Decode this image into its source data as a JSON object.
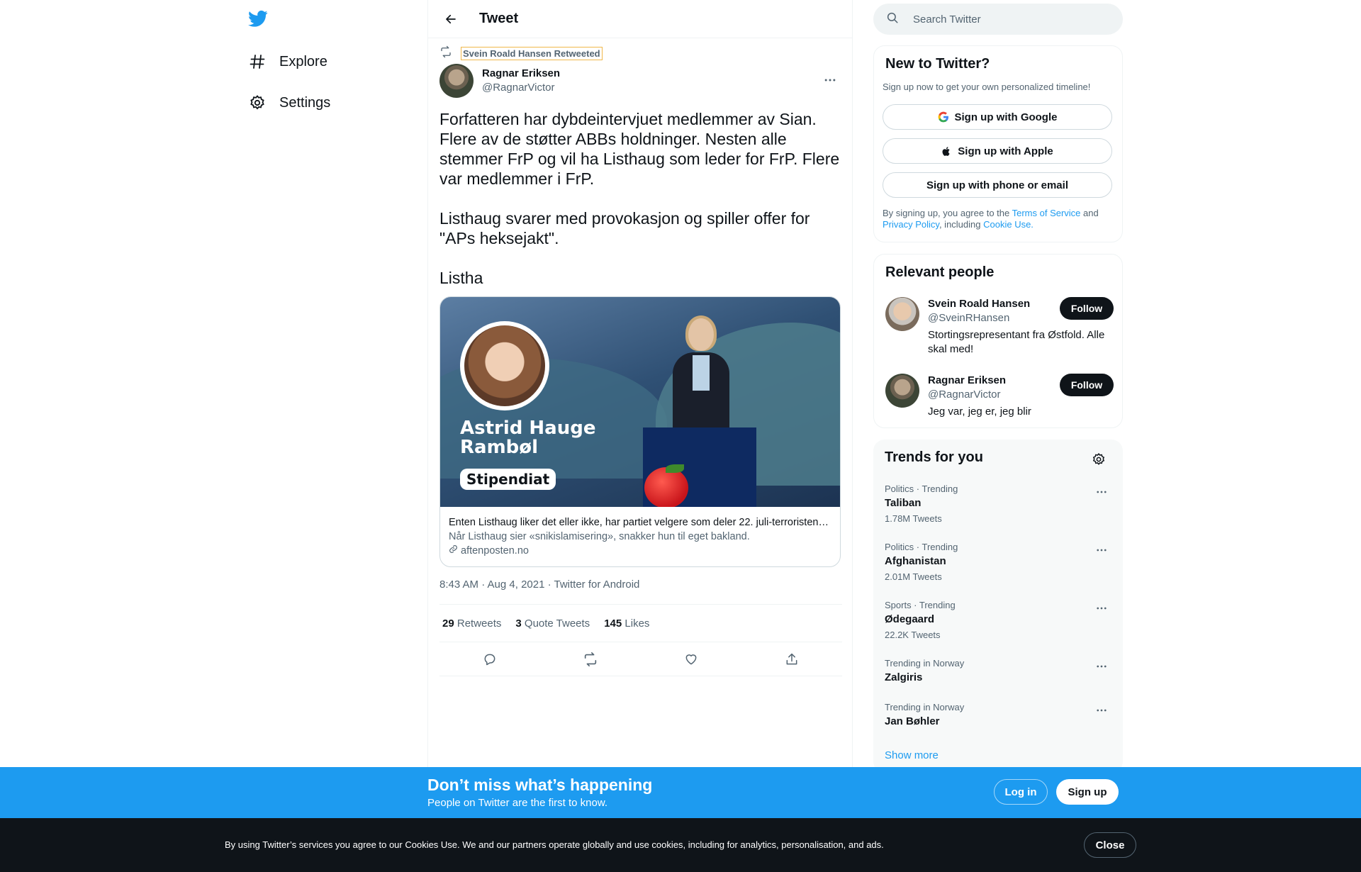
{
  "nav": {
    "items": [
      {
        "label": "Explore",
        "icon": "hashtag-icon"
      },
      {
        "label": "Settings",
        "icon": "gear-icon"
      }
    ]
  },
  "header": {
    "title": "Tweet"
  },
  "tweet": {
    "retweeted_by": "Svein Roald Hansen Retweeted",
    "author_name": "Ragnar Eriksen",
    "author_handle": "@RagnarVictor",
    "paragraphs": [
      "Forfatteren har dybdeintervjuet medlemmer av Sian. Flere av de støtter ABBs holdninger. Nesten alle stemmer FrP og vil ha Listhaug som leder for FrP. Flere var medlemmer i FrP.",
      "Listhaug svarer med provokasjon og spiller offer for \"APs heksejakt\".",
      "Listha"
    ],
    "card": {
      "image_name": "Astrid Hauge Rambøl",
      "image_badge": "Stipendiat",
      "title": "Enten Listhaug liker det eller ikke, har partiet velgere som deler 22. juli-terroristens virkelighetsforståelse",
      "description": "Når Listhaug sier «snikislamisering», snakker hun til eget bakland.",
      "domain": "aftenposten.no"
    },
    "timestamp": "8:43 AM · Aug 4, 2021 · Twitter for Android",
    "stats": {
      "retweets_count": "29",
      "retweets_label": "Retweets",
      "quotes_count": "3",
      "quotes_label": "Quote Tweets",
      "likes_count": "145",
      "likes_label": "Likes"
    }
  },
  "search": {
    "placeholder": "Search Twitter"
  },
  "new_to_twitter": {
    "title": "New to Twitter?",
    "subtitle": "Sign up now to get your own personalized timeline!",
    "google_label": "Sign up with Google",
    "apple_label": "Sign up with Apple",
    "phone_label": "Sign up with phone or email",
    "legal_prefix": "By signing up, you agree to the ",
    "terms": "Terms of Service",
    "legal_and": " and ",
    "privacy": "Privacy Policy",
    "legal_including": ", including ",
    "cookie": "Cookie Use."
  },
  "relevant_people": {
    "title": "Relevant people",
    "follow_label": "Follow",
    "people": [
      {
        "name": "Svein Roald Hansen",
        "handle": "@SveinRHansen",
        "bio": "Stortingsrepresentant fra Østfold. Alle skal med!"
      },
      {
        "name": "Ragnar Eriksen",
        "handle": "@RagnarVictor",
        "bio": "Jeg var, jeg er, jeg blir"
      }
    ]
  },
  "trends": {
    "title": "Trends for you",
    "items": [
      {
        "context": "Politics · Trending",
        "name": "Taliban",
        "count": "1.78M Tweets"
      },
      {
        "context": "Politics · Trending",
        "name": "Afghanistan",
        "count": "2.01M Tweets"
      },
      {
        "context": "Sports · Trending",
        "name": "Ødegaard",
        "count": "22.2K Tweets"
      },
      {
        "context": "Trending in Norway",
        "name": "Zalgiris",
        "count": ""
      },
      {
        "context": "Trending in Norway",
        "name": "Jan Bøhler",
        "count": ""
      }
    ],
    "show_more": "Show more"
  },
  "banner": {
    "title": "Don’t miss what’s happening",
    "subtitle": "People on Twitter are the first to know.",
    "login": "Log in",
    "signup": "Sign up"
  },
  "cookie_bar": {
    "text": "By using Twitter’s services you agree to our Cookies Use. We and our partners operate globally and use cookies, including for analytics, personalisation, and ads.",
    "close": "Close"
  },
  "colors": {
    "accent": "#1d9bf0",
    "text": "#0f1419",
    "secondary": "#536471",
    "banner": "#1d9bf0",
    "cookie_bar": "#0f1419"
  }
}
